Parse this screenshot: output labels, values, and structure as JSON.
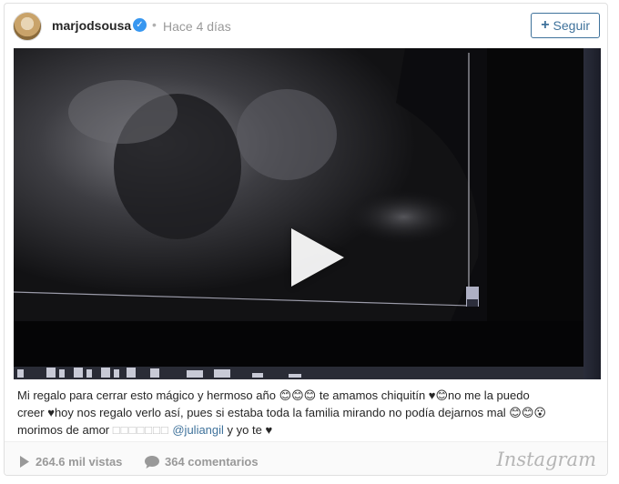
{
  "post": {
    "username": "marjodsousa",
    "verified_icon": "verified-badge-icon",
    "separator": "•",
    "time": "Hace 4 días",
    "follow_label": "Seguir",
    "follow_icon": "+"
  },
  "media": {
    "type": "video",
    "play_icon": "play-icon"
  },
  "caption": {
    "line1": "Mi regalo para cerrar esto mágico y hermoso año 😊😊😊 te amamos chiquitín ♥😊no me la puedo",
    "line2": "creer ♥hoy nos regalo verlo así, pues si estaba toda la familia mirando no podía dejarnos mal 😊😊😮",
    "line3_text": "morimos de amor",
    "line3_boxes": "□□□□□□□",
    "mention": "@juliangil",
    "line3_tail": "y yo te ♥"
  },
  "footer": {
    "views": "264.6 mil vistas",
    "comments": "364 comentarios",
    "brand": "Instagram"
  },
  "colors": {
    "accent": "#3f729b",
    "verified": "#3897f0",
    "muted": "#999999"
  }
}
